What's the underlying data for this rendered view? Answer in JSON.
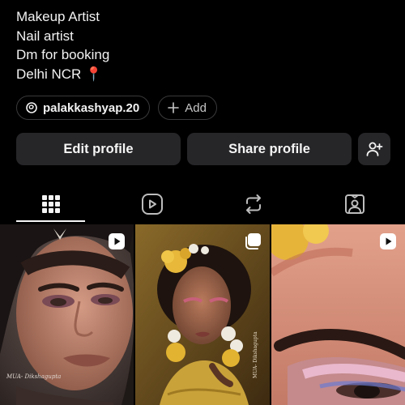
{
  "bio": {
    "lines": [
      "Makeup Artist",
      "Nail artist",
      "Dm for booking",
      "Delhi NCR 📍"
    ]
  },
  "links": {
    "handle": "palakkashyap.20",
    "add_label": "Add"
  },
  "actions": {
    "edit_label": "Edit profile",
    "share_label": "Share profile"
  },
  "tabs": [
    {
      "name": "grid-icon",
      "active": true
    },
    {
      "name": "reels-icon",
      "active": false
    },
    {
      "name": "reposts-icon",
      "active": false
    },
    {
      "name": "tagged-icon",
      "active": false
    }
  ],
  "posts": [
    {
      "type": "reel",
      "badge_icon": "reel-icon",
      "watermark": "MUA- Dikshagupta"
    },
    {
      "type": "carousel",
      "badge_icon": "carousel-icon",
      "watermark": "MUA- Dikshagupta"
    },
    {
      "type": "reel",
      "badge_icon": "reel-icon",
      "watermark": ""
    }
  ]
}
